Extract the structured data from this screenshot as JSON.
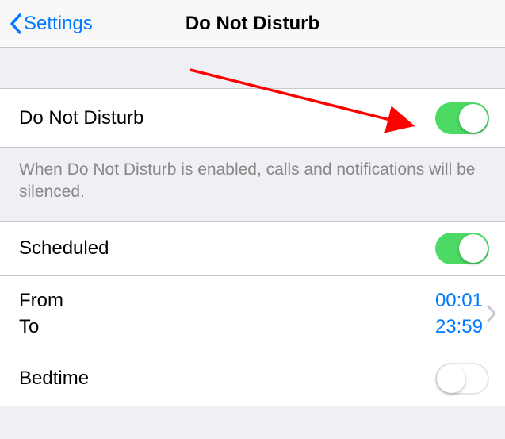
{
  "header": {
    "back_label": "Settings",
    "title": "Do Not Disturb"
  },
  "dnd": {
    "label": "Do Not Disturb",
    "enabled": true,
    "footer": "When Do Not Disturb is enabled, calls and notifications will be silenced."
  },
  "scheduled": {
    "label": "Scheduled",
    "enabled": true,
    "from_label": "From",
    "to_label": "To",
    "from_value": "00:01",
    "to_value": "23:59"
  },
  "bedtime": {
    "label": "Bedtime",
    "enabled": false
  },
  "colors": {
    "accent": "#007aff",
    "toggle_on": "#4cd964",
    "arrow": "#ff0000"
  }
}
